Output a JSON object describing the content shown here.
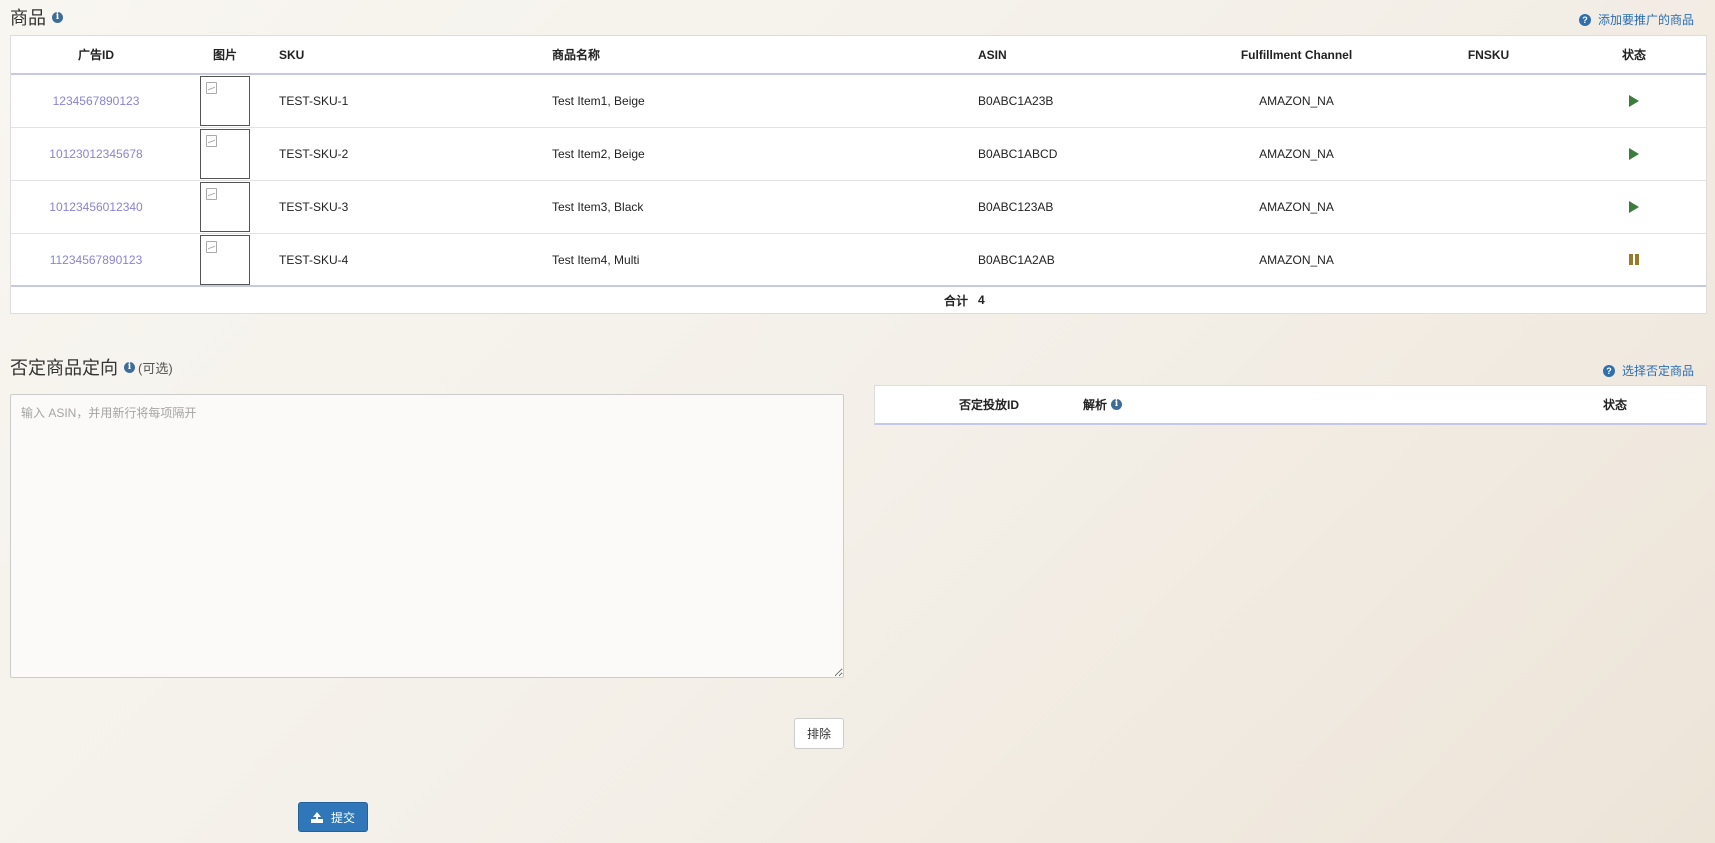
{
  "products": {
    "title": "商品",
    "help_link": "添加要推广的商品",
    "columns": {
      "ad_id": "广告ID",
      "image": "图片",
      "sku": "SKU",
      "name": "商品名称",
      "asin": "ASIN",
      "fulfillment": "Fulfillment Channel",
      "fnsku": "FNSKU",
      "status": "状态"
    },
    "rows": [
      {
        "ad_id": "1234567890123",
        "sku": "TEST-SKU-1",
        "name": "Test Item1, Beige",
        "asin": "B0ABC1A23B",
        "fulfillment": "AMAZON_NA",
        "fnsku": "",
        "status": "running"
      },
      {
        "ad_id": "10123012345678",
        "sku": "TEST-SKU-2",
        "name": "Test Item2, Beige",
        "asin": "B0ABC1ABCD",
        "fulfillment": "AMAZON_NA",
        "fnsku": "",
        "status": "running"
      },
      {
        "ad_id": "10123456012340",
        "sku": "TEST-SKU-3",
        "name": "Test Item3, Black",
        "asin": "B0ABC123AB",
        "fulfillment": "AMAZON_NA",
        "fnsku": "",
        "status": "running"
      },
      {
        "ad_id": "11234567890123",
        "sku": "TEST-SKU-4",
        "name": "Test Item4, Multi",
        "asin": "B0ABC1A2AB",
        "fulfillment": "AMAZON_NA",
        "fnsku": "",
        "status": "paused"
      }
    ],
    "total_label": "合计",
    "total_value": "4"
  },
  "negative": {
    "title": "否定商品定向",
    "optional": "(可选)",
    "help_link": "选择否定商品",
    "placeholder": "输入 ASIN，并用新行将每项隔开",
    "columns": {
      "id": "否定投放ID",
      "parse": "解析",
      "status": "状态"
    },
    "exclude_button": "排除"
  },
  "submit_button": "提交",
  "colors": {
    "link": "#8a83d6",
    "running": "#3b7d3b",
    "paused": "#9a7a2a",
    "primary": "#2f77b8"
  }
}
